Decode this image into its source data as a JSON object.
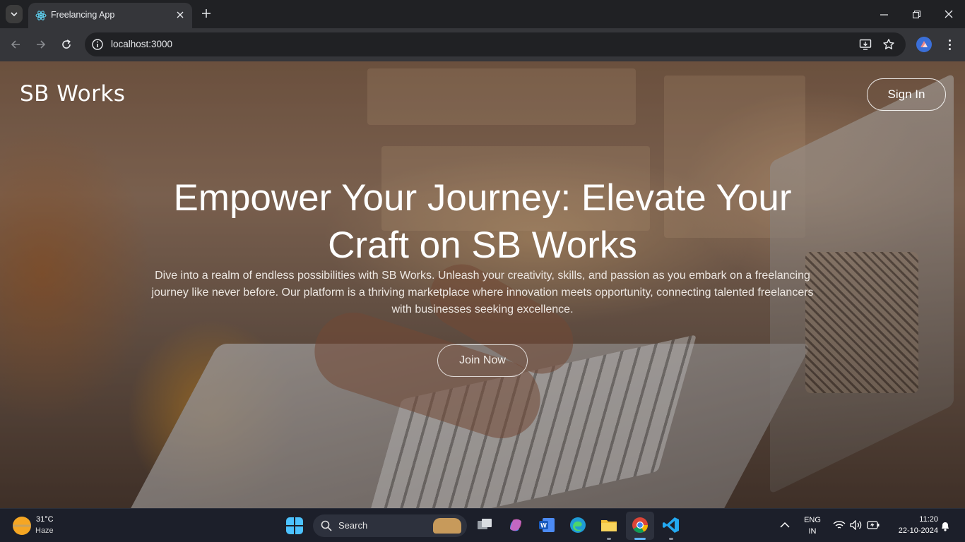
{
  "browser": {
    "tab_title": "Freelancing App",
    "url": "localhost:3000"
  },
  "page": {
    "brand": "SB Works",
    "signin_label": "Sign In",
    "headline": "Empower Your Journey: Elevate Your Craft on SB Works",
    "subtext": "Dive into a realm of endless possibilities with SB Works. Unleash your creativity, skills, and passion as you embark on a freelancing journey like never before. Our platform is a thriving marketplace where innovation meets opportunity, connecting talented freelancers with businesses seeking excellence.",
    "cta_label": "Join Now"
  },
  "taskbar": {
    "weather_temp": "31°C",
    "weather_condition": "Haze",
    "search_label": "Search",
    "language_line1": "ENG",
    "language_line2": "IN",
    "time": "11:20",
    "date": "22-10-2024"
  },
  "colors": {
    "browser_frame": "#202124",
    "toolbar": "#35363a",
    "taskbar": "#1c1f2a",
    "accent_blue": "#5fb2f2"
  }
}
